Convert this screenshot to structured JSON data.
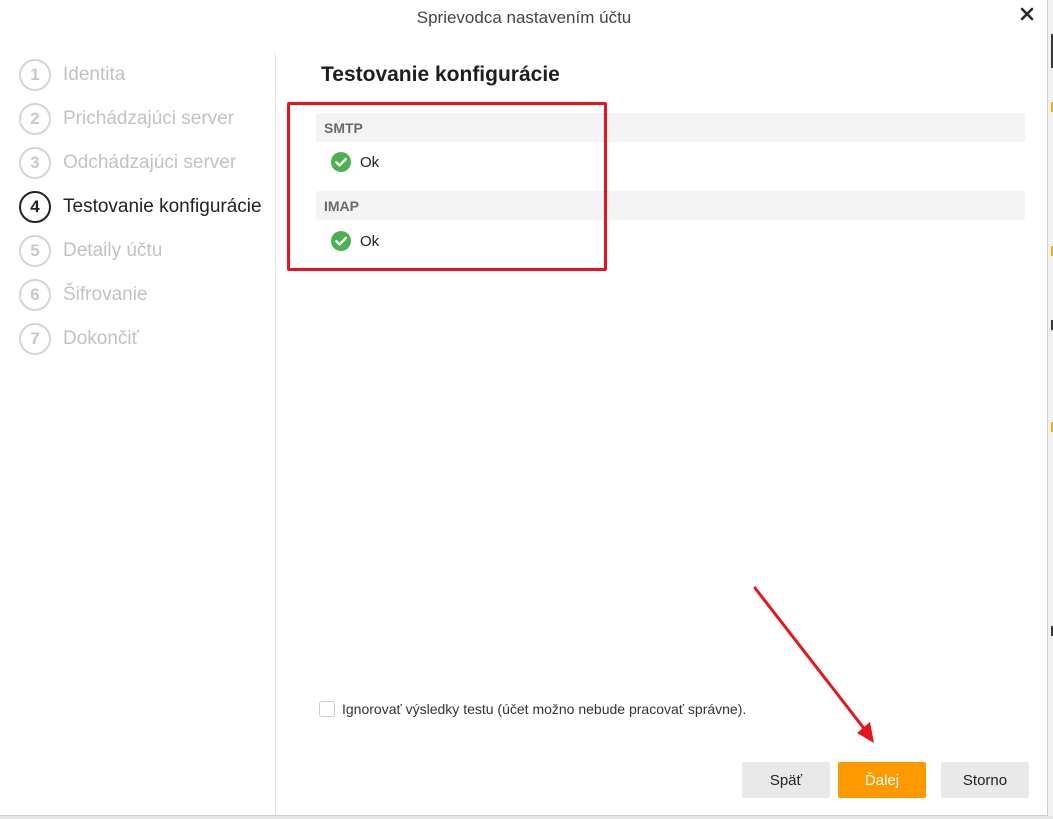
{
  "window": {
    "title": "Sprievodca nastavením účtu",
    "close_icon": "close-icon"
  },
  "steps": [
    {
      "number": "1",
      "label": "Identita",
      "state": "inactive"
    },
    {
      "number": "2",
      "label": "Prichádzajúci server",
      "state": "inactive"
    },
    {
      "number": "3",
      "label": "Odchádzajúci server",
      "state": "inactive"
    },
    {
      "number": "4",
      "label": "Testovanie konfigurácie",
      "state": "active"
    },
    {
      "number": "5",
      "label": "Detaily účtu",
      "state": "inactive"
    },
    {
      "number": "6",
      "label": "Šifrovanie",
      "state": "inactive"
    },
    {
      "number": "7",
      "label": "Dokončiť",
      "state": "inactive"
    }
  ],
  "main": {
    "title": "Testovanie konfigurácie",
    "tests": [
      {
        "name": "SMTP",
        "result": "Ok",
        "status": "success"
      },
      {
        "name": "IMAP",
        "result": "Ok",
        "status": "success"
      }
    ],
    "ignore_checkbox": {
      "label": "Ignorovať výsledky testu (účet možno nebude pracovať správne).",
      "checked": false
    }
  },
  "buttons": {
    "back": "Späť",
    "next": "Ďalej",
    "cancel": "Storno"
  },
  "colors": {
    "accent": "#ff9900",
    "success": "#4caf50",
    "annotation": "#e8141b"
  }
}
